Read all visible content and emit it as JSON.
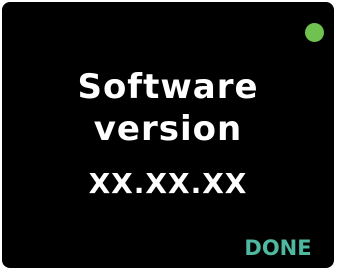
{
  "screen": {
    "title_line1": "Software",
    "title_line2": "version",
    "version_value": "XX.XX.XX",
    "done_label": "DONE"
  },
  "colors": {
    "background": "#000000",
    "text": "#ffffff",
    "status_indicator": "#6fc24f",
    "accent": "#4fb8a0"
  },
  "icons": {
    "status_indicator": "status-dot-icon"
  }
}
